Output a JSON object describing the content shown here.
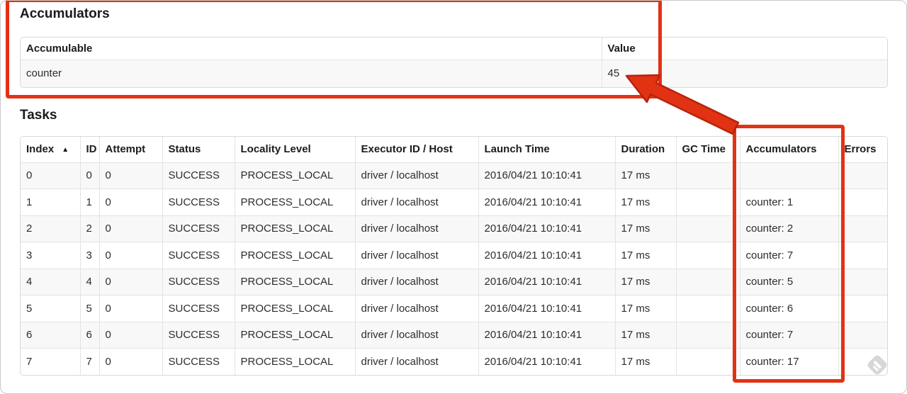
{
  "accumulators": {
    "heading": "Accumulators",
    "headers": [
      "Accumulable",
      "Value"
    ],
    "rows": [
      {
        "accumulable": "counter",
        "value": "45"
      }
    ]
  },
  "tasks": {
    "heading": "Tasks",
    "headers": [
      "Index",
      "ID",
      "Attempt",
      "Status",
      "Locality Level",
      "Executor ID / Host",
      "Launch Time",
      "Duration",
      "GC Time",
      "Accumulators",
      "Errors"
    ],
    "sort": {
      "column": "Index",
      "icon": "▲"
    },
    "rows": [
      {
        "index": "0",
        "id": "0",
        "attempt": "0",
        "status": "SUCCESS",
        "locality": "PROCESS_LOCAL",
        "executor": "driver / localhost",
        "launch_time": "2016/04/21 10:10:41",
        "duration": "17 ms",
        "gc_time": "",
        "accumulators": "",
        "errors": ""
      },
      {
        "index": "1",
        "id": "1",
        "attempt": "0",
        "status": "SUCCESS",
        "locality": "PROCESS_LOCAL",
        "executor": "driver / localhost",
        "launch_time": "2016/04/21 10:10:41",
        "duration": "17 ms",
        "gc_time": "",
        "accumulators": "counter: 1",
        "errors": ""
      },
      {
        "index": "2",
        "id": "2",
        "attempt": "0",
        "status": "SUCCESS",
        "locality": "PROCESS_LOCAL",
        "executor": "driver / localhost",
        "launch_time": "2016/04/21 10:10:41",
        "duration": "17 ms",
        "gc_time": "",
        "accumulators": "counter: 2",
        "errors": ""
      },
      {
        "index": "3",
        "id": "3",
        "attempt": "0",
        "status": "SUCCESS",
        "locality": "PROCESS_LOCAL",
        "executor": "driver / localhost",
        "launch_time": "2016/04/21 10:10:41",
        "duration": "17 ms",
        "gc_time": "",
        "accumulators": "counter: 7",
        "errors": ""
      },
      {
        "index": "4",
        "id": "4",
        "attempt": "0",
        "status": "SUCCESS",
        "locality": "PROCESS_LOCAL",
        "executor": "driver / localhost",
        "launch_time": "2016/04/21 10:10:41",
        "duration": "17 ms",
        "gc_time": "",
        "accumulators": "counter: 5",
        "errors": ""
      },
      {
        "index": "5",
        "id": "5",
        "attempt": "0",
        "status": "SUCCESS",
        "locality": "PROCESS_LOCAL",
        "executor": "driver / localhost",
        "launch_time": "2016/04/21 10:10:41",
        "duration": "17 ms",
        "gc_time": "",
        "accumulators": "counter: 6",
        "errors": ""
      },
      {
        "index": "6",
        "id": "6",
        "attempt": "0",
        "status": "SUCCESS",
        "locality": "PROCESS_LOCAL",
        "executor": "driver / localhost",
        "launch_time": "2016/04/21 10:10:41",
        "duration": "17 ms",
        "gc_time": "",
        "accumulators": "counter: 7",
        "errors": ""
      },
      {
        "index": "7",
        "id": "7",
        "attempt": "0",
        "status": "SUCCESS",
        "locality": "PROCESS_LOCAL",
        "executor": "driver / localhost",
        "launch_time": "2016/04/21 10:10:41",
        "duration": "17 ms",
        "gc_time": "",
        "accumulators": "counter: 17",
        "errors": ""
      }
    ]
  },
  "annotations": {
    "color": "#e23214",
    "outline": "#b5240c"
  },
  "watermark": {
    "icon": "feather-diamond-badge",
    "color": "#d7d7d7"
  }
}
